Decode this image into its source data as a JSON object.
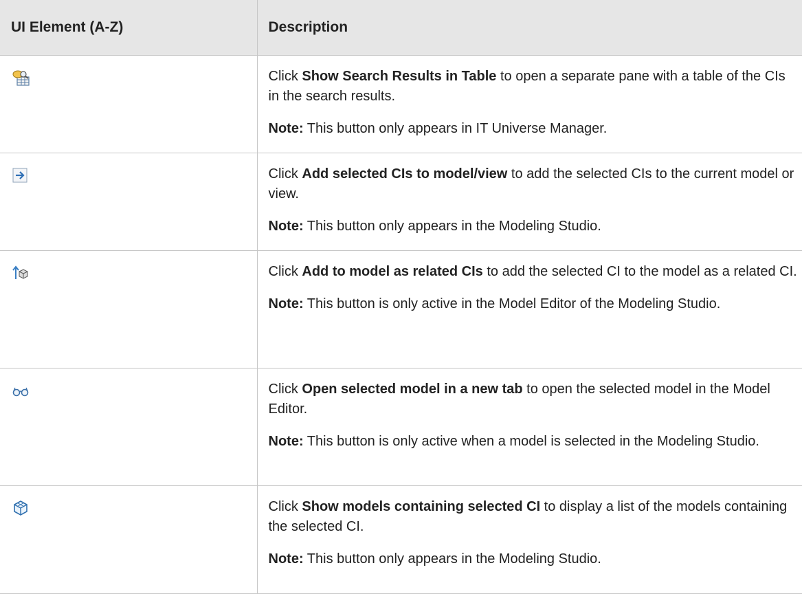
{
  "header": {
    "col1": "UI Element (A-Z)",
    "col2": "Description"
  },
  "rows": [
    {
      "icon": "show-search-results-table-icon",
      "click": "Click ",
      "name": "Show Search Results in Table",
      "desc": " to open a separate pane with a table of the CIs in the search results.",
      "note_label": "Note:",
      "note": " This button only appears in IT Universe Manager."
    },
    {
      "icon": "add-to-model-arrow-icon",
      "click": "Click ",
      "name": "Add selected CIs to model/view",
      "desc": " to add the selected CIs to the current model or view.",
      "note_label": "Note:",
      "note": " This button only appears in the Modeling Studio."
    },
    {
      "icon": "add-related-ci-icon",
      "click": "Click ",
      "name": "Add to model as related CIs",
      "desc": " to add the selected CI to the model as a related CI.",
      "note_label": "Note:",
      "note": " This button is only active in the Model Editor of the Modeling Studio."
    },
    {
      "icon": "glasses-icon",
      "click": "Click ",
      "name": "Open selected model in a new tab",
      "desc": " to open the selected model in the Model Editor.",
      "note_label": "Note:",
      "note": " This button is only active when a model is selected in the Modeling Studio."
    },
    {
      "icon": "model-cube-icon",
      "click": "Click ",
      "name": "Show models containing selected CI",
      "desc": " to display a list of the models containing the selected CI.",
      "note_label": "Note:",
      "note": " This button only appears in the Modeling Studio."
    }
  ]
}
